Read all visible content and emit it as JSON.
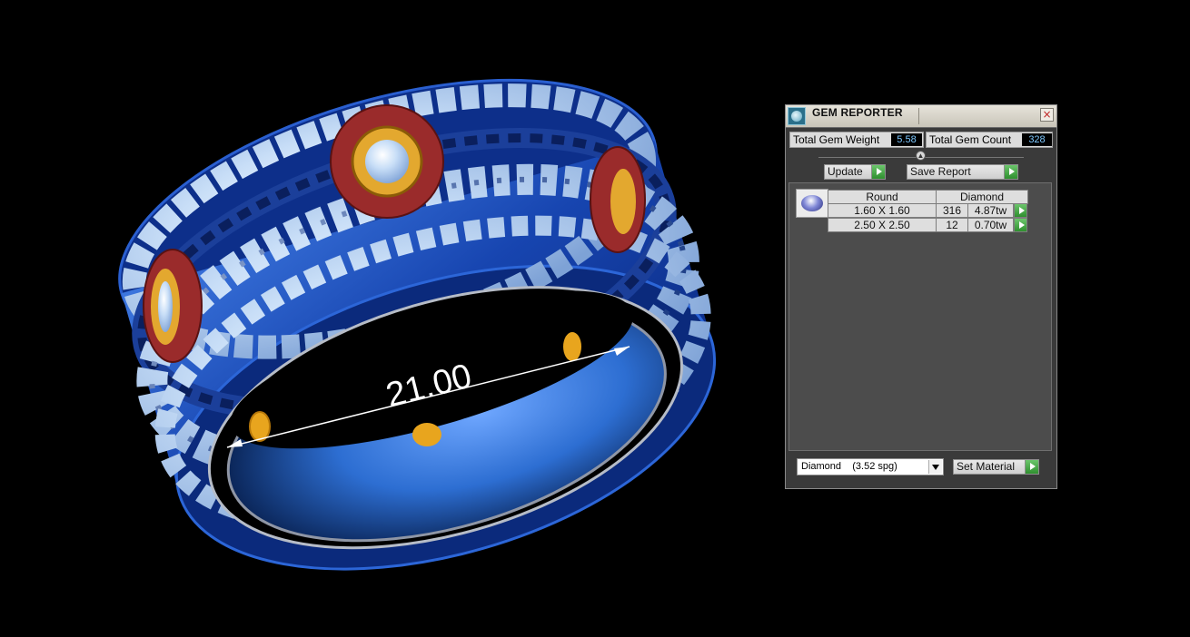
{
  "viewport": {
    "dimension_label": "21.00"
  },
  "panel": {
    "title": "GEM REPORTER",
    "close_symbol": "×",
    "total_weight_label": "Total Gem Weight",
    "total_weight_value": "5.58",
    "total_count_label": "Total Gem Count",
    "total_count_value": "328",
    "update_label": "Update",
    "save_report_label": "Save Report",
    "table": {
      "headers": [
        "Round",
        "Diamond"
      ],
      "rows": [
        {
          "size": "1.60 X 1.60",
          "count": "316",
          "weight": "4.87tw"
        },
        {
          "size": "2.50 X 2.50",
          "count": "12",
          "weight": "0.70tw"
        }
      ]
    },
    "material_select": "Diamond    (3.52 spg)",
    "set_material_label": "Set Material"
  }
}
